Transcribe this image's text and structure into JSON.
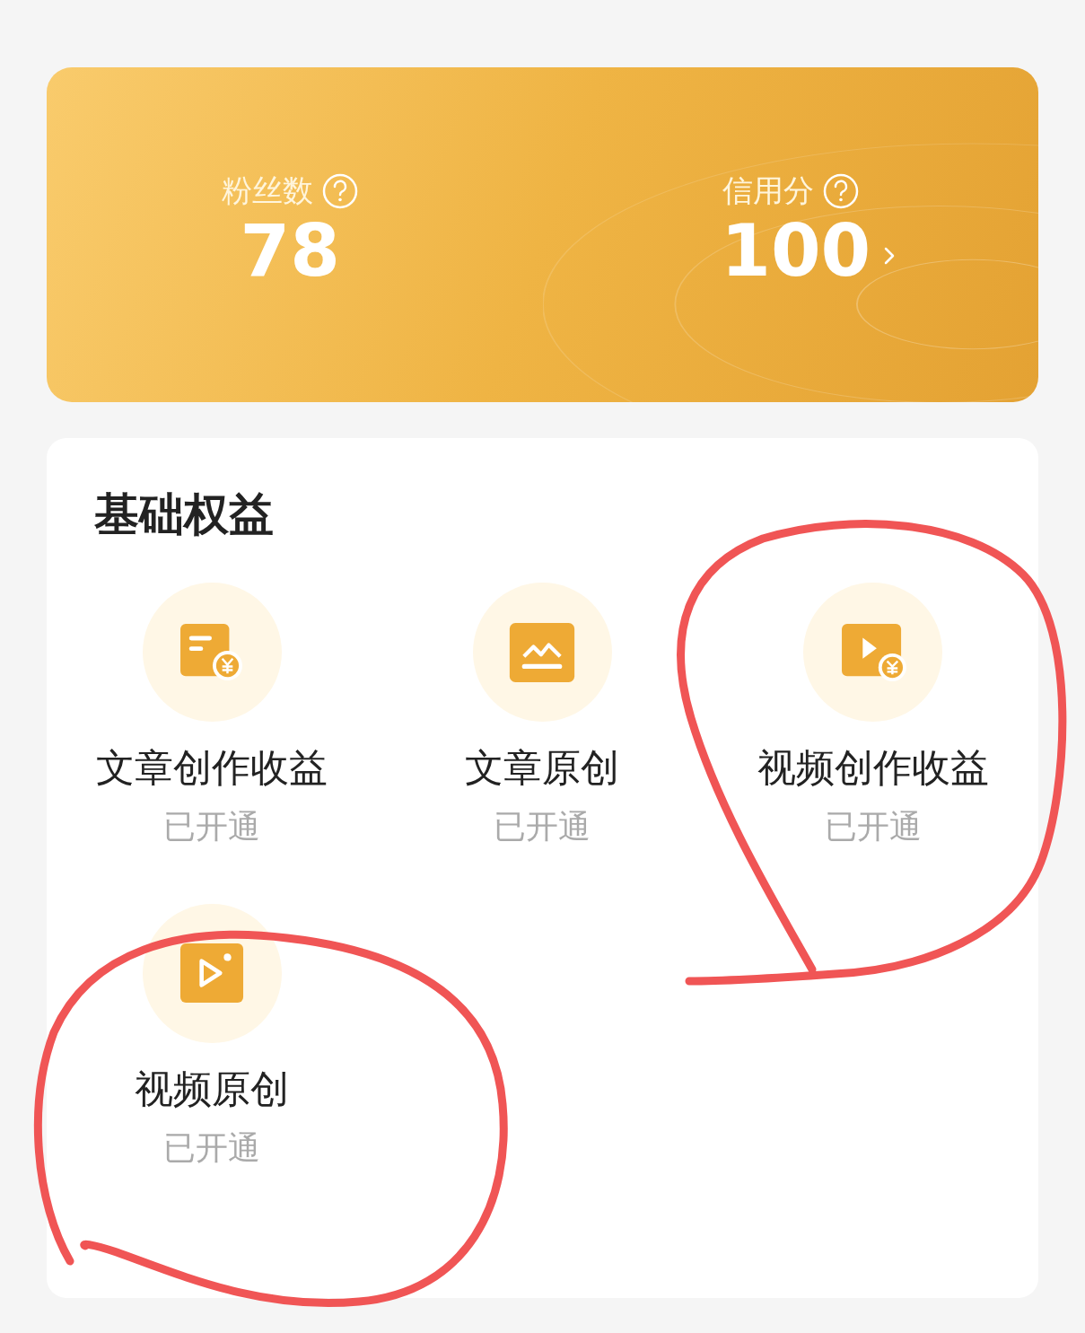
{
  "stats": [
    {
      "label": "粉丝数",
      "value": "78",
      "link": false
    },
    {
      "label": "信用分",
      "value": "100",
      "link": true
    }
  ],
  "benefits": {
    "title": "基础权益",
    "items": [
      {
        "kind": "article-income",
        "name": "文章创作收益",
        "status": "已开通"
      },
      {
        "kind": "article-original",
        "name": "文章原创",
        "status": "已开通"
      },
      {
        "kind": "video-income",
        "name": "视频创作收益",
        "status": "已开通"
      },
      {
        "kind": "video-original",
        "name": "视频原创",
        "status": "已开通"
      }
    ]
  }
}
